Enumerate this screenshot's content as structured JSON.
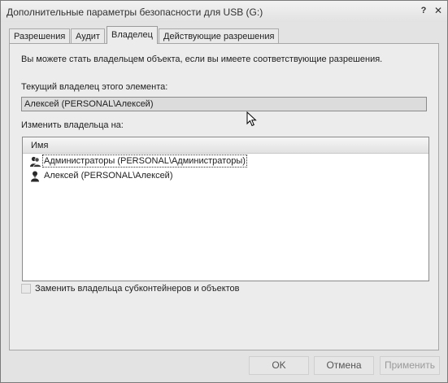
{
  "window": {
    "title": "Дополнительные параметры безопасности для USB (G:)",
    "help_glyph": "?",
    "close_glyph": "✕"
  },
  "tabs": [
    {
      "label": "Разрешения",
      "active": false
    },
    {
      "label": "Аудит",
      "active": false
    },
    {
      "label": "Владелец",
      "active": true
    },
    {
      "label": "Действующие разрешения",
      "active": false
    }
  ],
  "owner_tab": {
    "info_text": "Вы можете стать владельцем объекта, если вы имеете соответствующие разрешения.",
    "current_owner_label": "Текущий владелец этого элемента:",
    "current_owner_value": "Алексей (PERSONAL\\Алексей)",
    "change_owner_label": "Изменить владельца на:",
    "list": {
      "column_header": "Имя",
      "items": [
        {
          "icon": "user-group-icon",
          "label": "Администраторы (PERSONAL\\Администраторы)",
          "focused": true
        },
        {
          "icon": "user-icon",
          "label": "Алексей (PERSONAL\\Алексей)",
          "focused": false
        }
      ]
    },
    "replace_checkbox_label": "Заменить владельца субконтейнеров и объектов",
    "replace_checkbox_checked": false
  },
  "buttons": {
    "ok": "OK",
    "cancel": "Отмена",
    "apply": "Применить"
  },
  "colors": {
    "window_bg": "#e3e3e3",
    "panel_bg": "#ececec",
    "list_bg": "#ffffff"
  }
}
